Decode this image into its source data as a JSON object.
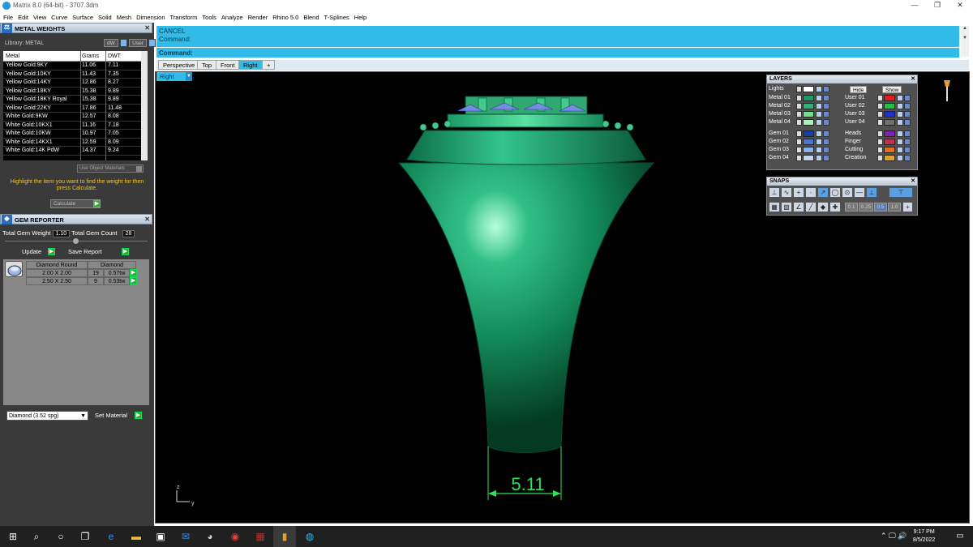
{
  "window": {
    "title": "Matrix 8.0 (64-bit) - 3707.3dm",
    "minimize": "—",
    "maximize": "❐",
    "close": "✕"
  },
  "menu": [
    "File",
    "Edit",
    "View",
    "Curve",
    "Surface",
    "Solid",
    "Mesh",
    "Dimension",
    "Transform",
    "Tools",
    "Analyze",
    "Render",
    "Rhino 5.0",
    "Blend",
    "T-Splines",
    "Help"
  ],
  "metal_weights": {
    "title": "METAL WEIGHTS",
    "library_label": "Library: METAL",
    "dw_btn": "dW",
    "user_btn": "User",
    "columns": [
      "Metal",
      "Grams",
      "DWT"
    ],
    "rows": [
      [
        "Yellow Gold:9KY",
        "11.06",
        "7.11"
      ],
      [
        "Yellow Gold:10KY",
        "11.43",
        "7.35"
      ],
      [
        "Yellow Gold:14KY",
        "12.86",
        "8.27"
      ],
      [
        "Yellow Gold:18KY",
        "15.38",
        "9.89"
      ],
      [
        "Yellow Gold:18KY Royal",
        "15.38",
        "9.89"
      ],
      [
        "Yellow Gold:22KY",
        "17.86",
        "11.48"
      ],
      [
        "White Gold:9KW",
        "12.57",
        "8.08"
      ],
      [
        "White Gold:10KX1",
        "11.16",
        "7.18"
      ],
      [
        "White Gold:10KW",
        "10.97",
        "7.05"
      ],
      [
        "White Gold:14KX1",
        "12.59",
        "8.09"
      ],
      [
        "White Gold:14K PdW",
        "14.37",
        "9.24"
      ]
    ],
    "use_object_materials": "Use Object Materials",
    "hint": "Highlight the item you want to find the weight for then press Calculate.",
    "calculate": "Calculate"
  },
  "gem_reporter": {
    "title": "GEM REPORTER",
    "total_weight_label": "Total Gem Weight",
    "total_weight": "1.10",
    "total_count_label": "Total Gem Count",
    "total_count": "28",
    "update": "Update",
    "save_report": "Save Report",
    "headers": [
      "Diamond Round",
      "Diamond"
    ],
    "rows": [
      [
        "2.00 X 2.00",
        "19",
        "0.57tw"
      ],
      [
        "2.50 X 2.50",
        "9",
        "0.53tw"
      ]
    ],
    "material": "Diamond    (3.52 spg)",
    "set_material": "Set Material"
  },
  "command": {
    "line1": "CANCEL",
    "line2": "Command:",
    "prompt": "Command:"
  },
  "tabs": [
    "Perspective",
    "Top",
    "Front",
    "Right",
    "+"
  ],
  "active_tab": 3,
  "viewport": {
    "label": "Right",
    "dimension": "5.11",
    "axis_z": "z",
    "axis_y": "y"
  },
  "layers": {
    "title": "LAYERS",
    "lights": "Lights",
    "hide": "Hide",
    "show": "Show",
    "left": [
      {
        "name": "Metal 01",
        "color": "#1e9a66"
      },
      {
        "name": "Metal 02",
        "color": "#2fb07a"
      },
      {
        "name": "Metal 03",
        "color": "#6fe08f"
      },
      {
        "name": "Metal 04",
        "color": "#a9f0b9"
      },
      {
        "name": "Gem 01",
        "color": "#1a3f9e"
      },
      {
        "name": "Gem 02",
        "color": "#4a78d0"
      },
      {
        "name": "Gem 03",
        "color": "#8ab0e8"
      },
      {
        "name": "Gem 04",
        "color": "#c0d4f2"
      }
    ],
    "right": [
      {
        "name": "User 01",
        "color": "#e02020"
      },
      {
        "name": "User 02",
        "color": "#20c040"
      },
      {
        "name": "User 03",
        "color": "#2030d0"
      },
      {
        "name": "User 04",
        "color": "#707070"
      },
      {
        "name": "Heads",
        "color": "#8020b0"
      },
      {
        "name": "Finger",
        "color": "#c03050"
      },
      {
        "name": "Cutting",
        "color": "#e07020"
      },
      {
        "name": "Creation",
        "color": "#e0a030"
      }
    ]
  },
  "snaps": {
    "title": "SNAPS",
    "values": [
      "0.1",
      "0.25",
      "0.5",
      "1.0"
    ]
  },
  "taskbar": {
    "time": "9:17 PM",
    "date": "8/5/2022"
  },
  "colors": {
    "accent": "#30bbe8",
    "model_green": "#1ea070",
    "dimension_green": "#2ee05a",
    "hint_yellow": "#f2c230"
  }
}
